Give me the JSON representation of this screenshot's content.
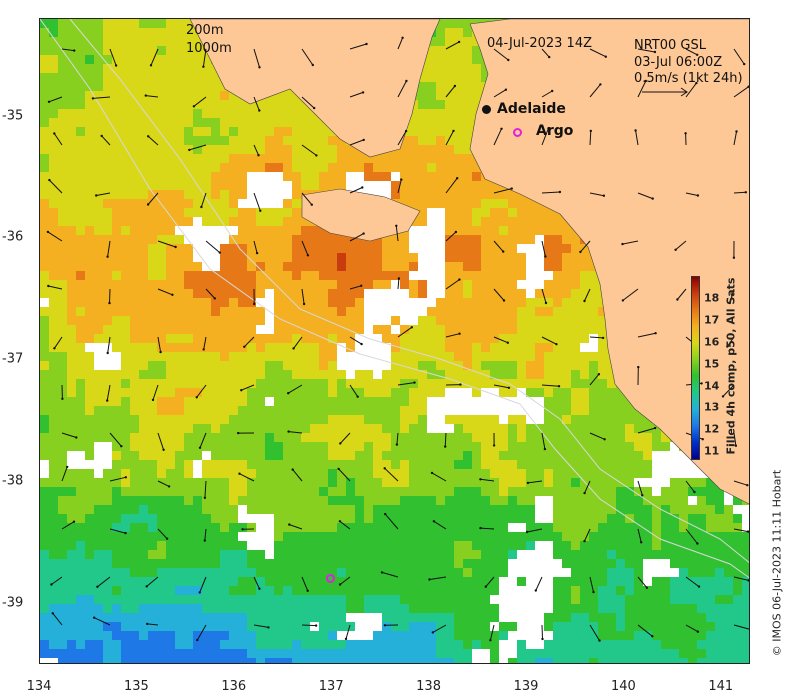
{
  "map": {
    "title_date": "04-Jul-2023 14Z",
    "product": "NRT00 GSL",
    "current_time": "03-Jul 06:00Z",
    "vector_scale": "0.5m/s (1kt 24h)",
    "contours": [
      "200m",
      "1000m"
    ],
    "places": [
      {
        "name": "Adelaide",
        "lon": 138.6,
        "lat": -34.93,
        "marker": "filled-dot"
      },
      {
        "name": "Argo",
        "lon": 138.9,
        "lat": -35.12,
        "marker": "magenta-ring"
      }
    ],
    "argo_float_lon": 137.0,
    "argo_float_lat": -38.78,
    "x_axis": {
      "min": 134,
      "max": 141.3,
      "ticks": [
        "134",
        "135",
        "136",
        "137",
        "138",
        "139",
        "140",
        "141"
      ]
    },
    "y_axis": {
      "min": -39.5,
      "max": -34.2,
      "ticks": [
        "-35",
        "-36",
        "-37",
        "-38",
        "-39"
      ]
    },
    "colorbar": {
      "title": "Filled 4h comp, p50, All Sats",
      "min": 10.6,
      "max": 19.0,
      "ticks": [
        "11",
        "12",
        "13",
        "14",
        "15",
        "16",
        "17",
        "18"
      ],
      "colors": [
        "#00008f",
        "#0030c8",
        "#1e78e6",
        "#24b0d8",
        "#22c88a",
        "#30c030",
        "#88d020",
        "#d8d818",
        "#f4b020",
        "#e67818",
        "#c83c10",
        "#8b0000"
      ]
    },
    "land_color": "#fdc895",
    "credit": "© IMOS 06-Jul-2023 11:11 Hobart"
  }
}
